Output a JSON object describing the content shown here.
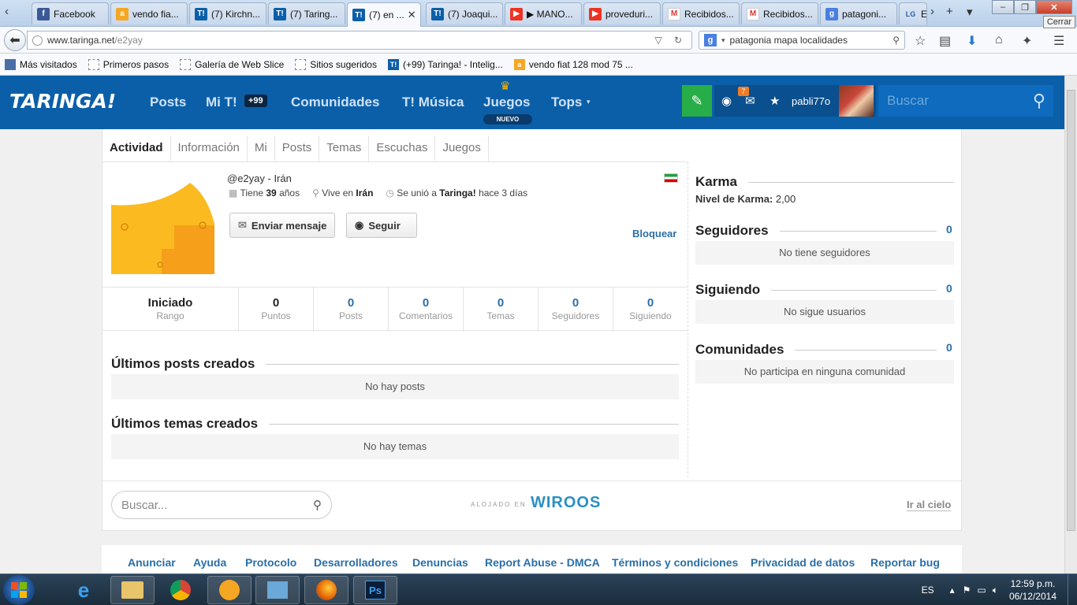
{
  "browser": {
    "tabs": [
      {
        "label": "Facebook",
        "icon": "facebook-icon",
        "kind": "fb"
      },
      {
        "label": "vendo fia...",
        "icon": "amazon-icon",
        "kind": "am"
      },
      {
        "label": "(7) Kirchn...",
        "icon": "taringa-icon",
        "kind": "tg"
      },
      {
        "label": "(7) Taring...",
        "icon": "taringa-icon",
        "kind": "tg"
      },
      {
        "label": "(7) en ...",
        "icon": "taringa-icon",
        "kind": "tg",
        "active": true
      },
      {
        "label": "(7) Joaqui...",
        "icon": "taringa-icon",
        "kind": "tg"
      },
      {
        "label": "▶ MANO...",
        "icon": "youtube-icon",
        "kind": "yt"
      },
      {
        "label": "proveduri...",
        "icon": "youtube-icon",
        "kind": "yt"
      },
      {
        "label": "Recibidos...",
        "icon": "gmail-icon",
        "kind": "gm"
      },
      {
        "label": "Recibidos...",
        "icon": "gmail-icon",
        "kind": "gm"
      },
      {
        "label": "patagoni...",
        "icon": "google-icon",
        "kind": "gg"
      },
      {
        "label": "E",
        "icon": "lg-icon",
        "kind": "lg"
      }
    ],
    "close_tooltip": "Cerrar",
    "url_host": "www.taringa.net",
    "url_path": "/e2yay",
    "search_query": "patagonia mapa localidades",
    "bookmarks": [
      {
        "label": "Más visitados",
        "kind": "folder"
      },
      {
        "label": "Primeros pasos",
        "kind": "page"
      },
      {
        "label": "Galería de Web Slice",
        "kind": "page"
      },
      {
        "label": "Sitios sugeridos",
        "kind": "page"
      },
      {
        "label": "(+99) Taringa! - Intelig...",
        "kind": "tg"
      },
      {
        "label": "vendo fiat 128 mod 75 ...",
        "kind": "am"
      }
    ]
  },
  "header": {
    "logo": "TARINGA!",
    "nav": {
      "posts": "Posts",
      "mi_t": "Mi T!",
      "mi_t_badge": "+99",
      "comunidades": "Comunidades",
      "musica": "T! Música",
      "juegos": "Juegos",
      "juegos_badge": "NUEVO",
      "tops": "Tops"
    },
    "notif_count": "7",
    "username": "pabli77o",
    "search_placeholder": "Buscar"
  },
  "profile": {
    "tabs": [
      "Actividad",
      "Información",
      "Mi",
      "Posts",
      "Temas",
      "Escuchas",
      "Juegos"
    ],
    "handle": "@e2yay - Irán",
    "age_prefix": "Tiene ",
    "age_value": "39",
    "age_suffix": " años",
    "lives_prefix": "Vive en ",
    "lives_value": "Irán",
    "joined_prefix": "Se unió a ",
    "joined_site": "Taringa!",
    "joined_suffix": " hace 3 días",
    "send_message": "Enviar mensaje",
    "follow": "Seguir",
    "block": "Bloquear"
  },
  "stats": [
    {
      "value": "Iniciado",
      "label": "Rango"
    },
    {
      "value": "0",
      "label": "Puntos"
    },
    {
      "value": "0",
      "label": "Posts"
    },
    {
      "value": "0",
      "label": "Comentarios"
    },
    {
      "value": "0",
      "label": "Temas"
    },
    {
      "value": "0",
      "label": "Seguidores"
    },
    {
      "value": "0",
      "label": "Siguiendo"
    }
  ],
  "main": {
    "posts_title": "Últimos posts creados",
    "posts_empty": "No hay posts",
    "temas_title": "Últimos temas creados",
    "temas_empty": "No hay temas"
  },
  "sidebar": {
    "karma_title": "Karma",
    "karma_label": "Nivel de Karma:",
    "karma_value": "2,00",
    "seguidores_title": "Seguidores",
    "seguidores_count": "0",
    "seguidores_empty": "No tiene seguidores",
    "siguiendo_title": "Siguiendo",
    "siguiendo_count": "0",
    "siguiendo_empty": "No sigue usuarios",
    "comunidades_title": "Comunidades",
    "comunidades_count": "0",
    "comunidades_empty": "No participa en ninguna comunidad"
  },
  "card_footer": {
    "search_placeholder": "Buscar...",
    "hosted_label": "ALOJADO EN",
    "hosted_brand": "WIROOS",
    "go_top": "Ir al cielo"
  },
  "footer_links": [
    "Anunciar",
    "Ayuda",
    "Protocolo",
    "Desarrolladores",
    "Denuncias",
    "Report Abuse - DMCA",
    "Términos y condiciones",
    "Privacidad de datos",
    "Reportar bug"
  ],
  "taskbar": {
    "lang": "ES",
    "time": "12:59 p.m.",
    "date": "06/12/2014"
  },
  "colors": {
    "header_blue": "#0b5fa8",
    "link_blue": "#2a6fa8",
    "compose_green": "#27ae48",
    "avatar_yellow": "#fbbb20"
  }
}
